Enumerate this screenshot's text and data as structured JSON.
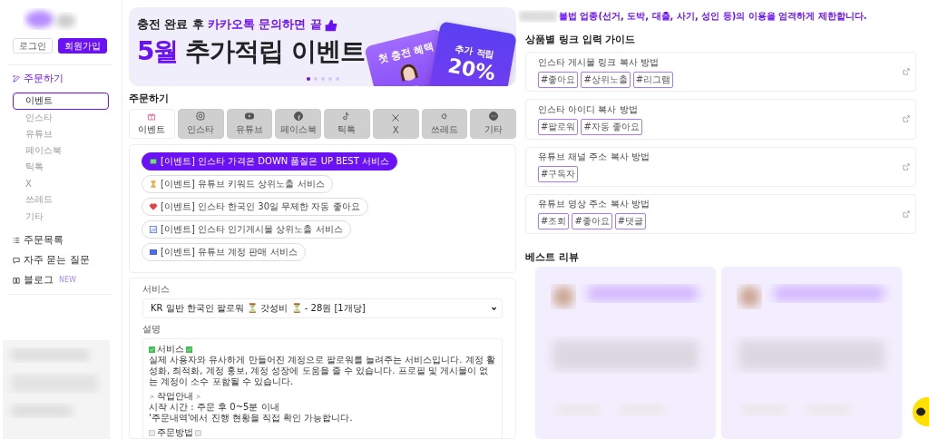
{
  "sidebar": {
    "auth_buttons": [
      {
        "label": "로그인",
        "kind": "outline"
      },
      {
        "label": "회원가입",
        "kind": "filled"
      }
    ],
    "order_menu": {
      "label": "주문하기",
      "items": [
        {
          "label": "이벤트",
          "selected": true
        },
        {
          "label": "인스타",
          "selected": false
        },
        {
          "label": "유튜브",
          "selected": false
        },
        {
          "label": "페이스북",
          "selected": false
        },
        {
          "label": "틱톡",
          "selected": false
        },
        {
          "label": "X",
          "selected": false
        },
        {
          "label": "쓰레드",
          "selected": false
        },
        {
          "label": "기타",
          "selected": false
        }
      ]
    },
    "links": [
      {
        "label": "주문목록",
        "kind": "list"
      },
      {
        "label": "자주 묻는 질문",
        "kind": "faq"
      },
      {
        "label": "블로그",
        "kind": "book",
        "badge": "NEW"
      }
    ]
  },
  "banner": {
    "subtitle_plain": "충전 완료 후 ",
    "subtitle_highlight": "카카오톡 문의하면 끝",
    "title_highlight": "5월",
    "title": "추가적립 이벤트",
    "card_1": "첫 충전 혜택",
    "card_2_line": "추가 적립",
    "card_2_value": "20%",
    "dots": [
      {
        "selected": true
      },
      {
        "selected": false
      },
      {
        "selected": false
      },
      {
        "selected": false
      },
      {
        "selected": false
      }
    ]
  },
  "order": {
    "heading": "주문하기",
    "tabs": [
      {
        "label": "이벤트",
        "kind": "gift",
        "selected": true
      },
      {
        "label": "인스타",
        "kind": "instagram",
        "selected": false
      },
      {
        "label": "유튜브",
        "kind": "youtube",
        "selected": false
      },
      {
        "label": "페이스북",
        "kind": "facebook",
        "selected": false
      },
      {
        "label": "틱톡",
        "kind": "tiktok",
        "selected": false
      },
      {
        "label": "X",
        "kind": "x",
        "selected": false
      },
      {
        "label": "쓰레드",
        "kind": "threads",
        "selected": false
      },
      {
        "label": "기타",
        "kind": "more",
        "selected": false
      }
    ],
    "services": [
      {
        "label": "[이벤트] 인스타 가격은 DOWN 품질은 UP BEST 서비스",
        "kind": "money",
        "selected": true
      },
      {
        "label": "[이벤트] 유튜브 키워드 상위노출 서비스",
        "kind": "trophy",
        "selected": false
      },
      {
        "label": "[이벤트] 인스타 한국인 30일 무제한 자동 좋아요",
        "kind": "heart",
        "selected": false
      },
      {
        "label": "[이벤트] 인스타 인기게시물 상위노출 서비스",
        "kind": "chart",
        "selected": false
      },
      {
        "label": "[이벤트] 유튜브 계정 판매 서비스",
        "kind": "film",
        "selected": false
      }
    ],
    "service_label": "서비스",
    "service_value": "KR 일반 한국인 팔로워 ⏳ 갓성비 ⏳ - 28원 [1개당]",
    "description_label": "설명",
    "description": [
      {
        "kind": "check",
        "text": "서비스"
      },
      {
        "kind": "text",
        "text": "실제 사용자와 유사하게 만들어진 계정으로 팔로워를 늘려주는 서비스입니다. 계정 활성화, 최적화, 계정 홍보, 계정 성장에 도움을 줄 수 있습니다. 프로필 및 게시물이 없는 계정이 소수 포함될 수 있습니다."
      },
      {
        "kind": "gap"
      },
      {
        "kind": "tools",
        "text": "작업안내"
      },
      {
        "kind": "text",
        "text": "시작 시간 : 주문 후 0~5분 이내"
      },
      {
        "kind": "text",
        "text": "'주문내역'에서 진행 현황을 직접 확인 가능합니다."
      },
      {
        "kind": "gap"
      },
      {
        "kind": "note",
        "text": "주문방법"
      }
    ]
  },
  "notice": "불법 업종(선거, 도박, 대출, 사기, 성인 등)의 이용을 엄격하게 제한합니다.",
  "guide": {
    "heading": "상품별 링크 입력 가이드",
    "items": [
      {
        "title": "인스타 게시물 링크 복사 방법",
        "tags": [
          "#좋아요",
          "#상위노출",
          "#리그램"
        ]
      },
      {
        "title": "인스타 아이디 복사 방법",
        "tags": [
          "#팔로워",
          "#자동 좋아요"
        ]
      },
      {
        "title": "유튜브 채널 주소 복사 방법",
        "tags": [
          "#구독자"
        ]
      },
      {
        "title": "유튜브 영상 주소 복사 방법",
        "tags": [
          "#조회",
          "#좋아요",
          "#댓글"
        ]
      }
    ]
  },
  "reviews": {
    "heading": "베스트 리뷰"
  }
}
